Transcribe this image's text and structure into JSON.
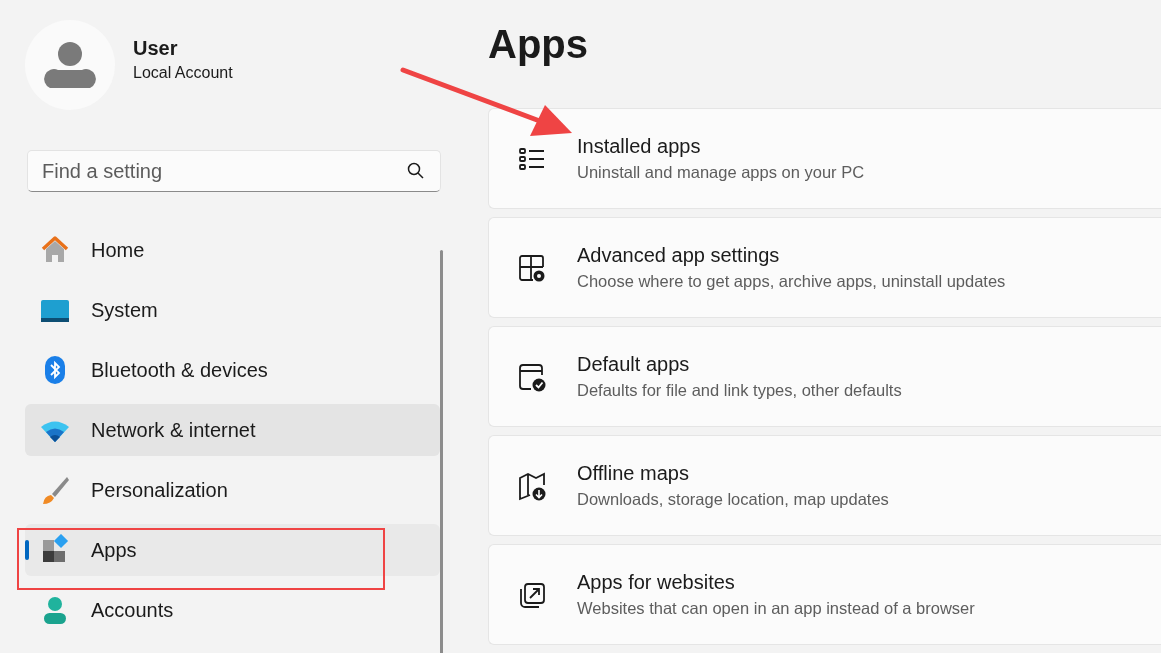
{
  "profile": {
    "name": "User",
    "account": "Local Account"
  },
  "search": {
    "placeholder": "Find a setting"
  },
  "nav": [
    {
      "label": "Home",
      "selected": false,
      "hovered": false
    },
    {
      "label": "System",
      "selected": false,
      "hovered": false
    },
    {
      "label": "Bluetooth & devices",
      "selected": false,
      "hovered": false
    },
    {
      "label": "Network & internet",
      "selected": false,
      "hovered": true
    },
    {
      "label": "Personalization",
      "selected": false,
      "hovered": false
    },
    {
      "label": "Apps",
      "selected": true,
      "hovered": false
    },
    {
      "label": "Accounts",
      "selected": false,
      "hovered": false
    }
  ],
  "page_title": "Apps",
  "cards": [
    {
      "title": "Installed apps",
      "description": "Uninstall and manage apps on your PC"
    },
    {
      "title": "Advanced app settings",
      "description": "Choose where to get apps, archive apps, uninstall updates"
    },
    {
      "title": "Default apps",
      "description": "Defaults for file and link types, other defaults"
    },
    {
      "title": "Offline maps",
      "description": "Downloads, storage location, map updates"
    },
    {
      "title": "Apps for websites",
      "description": "Websites that can open in an app instead of a browser"
    }
  ]
}
